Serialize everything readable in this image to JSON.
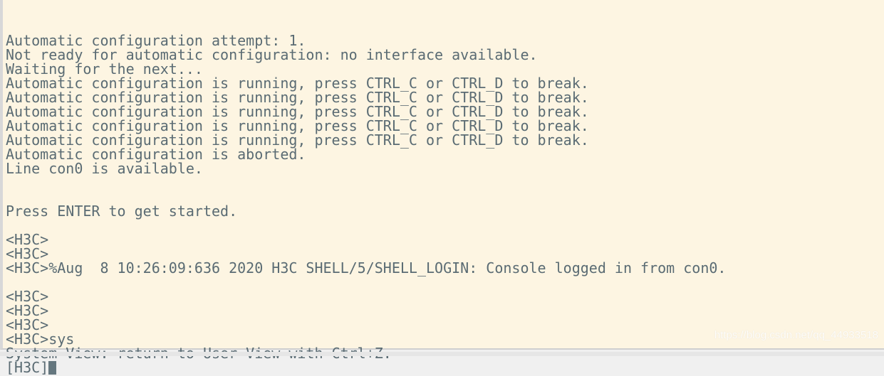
{
  "terminal": {
    "lines": [
      "Automatic configuration attempt: 1.",
      "Not ready for automatic configuration: no interface available.",
      "Waiting for the next...",
      "Automatic configuration is running, press CTRL_C or CTRL_D to break.",
      "Automatic configuration is running, press CTRL_C or CTRL_D to break.",
      "Automatic configuration is running, press CTRL_C or CTRL_D to break.",
      "Automatic configuration is running, press CTRL_C or CTRL_D to break.",
      "Automatic configuration is running, press CTRL_C or CTRL_D to break.",
      "Automatic configuration is aborted.",
      "Line con0 is available.",
      "",
      "",
      "Press ENTER to get started.",
      "",
      "<H3C>",
      "<H3C>",
      "<H3C>%Aug  8 10:26:09:636 2020 H3C SHELL/5/SHELL_LOGIN: Console logged in from con0.",
      "",
      "<H3C>",
      "<H3C>",
      "<H3C>",
      "<H3C>sys",
      "System View: return to User View with Ctrl+Z."
    ],
    "prompt": "[H3C]",
    "background_color": "#fdf5e2",
    "text_color": "#5a6b73"
  },
  "watermark": "https://blog.csdn.net/qq_44933518"
}
